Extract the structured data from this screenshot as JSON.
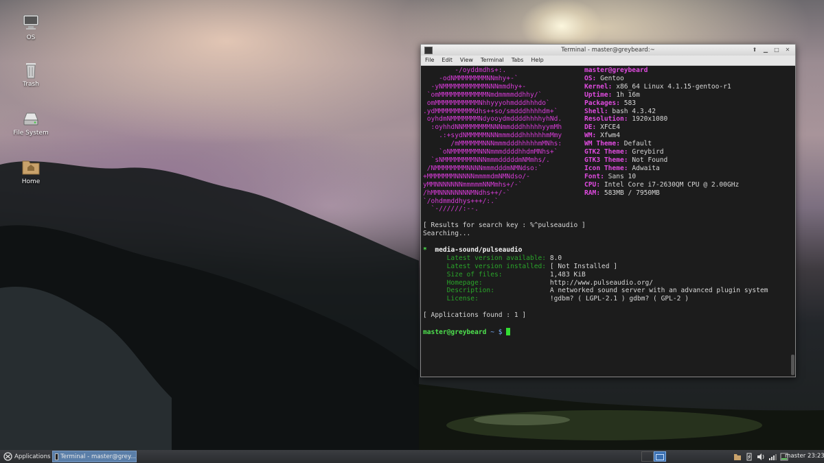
{
  "desktop_icons": [
    {
      "label": "OS",
      "icon": "monitor-icon"
    },
    {
      "label": "Trash",
      "icon": "trash-icon"
    },
    {
      "label": "File System",
      "icon": "drive-icon"
    },
    {
      "label": "Home",
      "icon": "home-folder-icon"
    }
  ],
  "terminal": {
    "title": "Terminal - master@greybeard:~",
    "menu": [
      "File",
      "Edit",
      "View",
      "Terminal",
      "Tabs",
      "Help"
    ],
    "logo_lines": [
      "        -/oyddmdhs+:.",
      "    -odNMMMMMMMMNNmhy+-`",
      "  -yNMMMMMMMMMMMNNNmmdhy+-",
      " `omMMMMMMMMMMMMNmdmmmmddhhy/`",
      " omMMMMMMMMMMMNhhyyyohmdddhhhdo`",
      ".ydMMMMMMMMMMdhs++so/smdddhhhhdm+`",
      " oyhdmNMMMMMMMNdyooydmddddhhhhyhNd.",
      "  :oyhhdNNMMMMMMMNNNmmdddhhhhhyymMh",
      "    .:+sydNMMMMMNNNmmmdddhhhhhhmMmy",
      "       /mMMMMMMNNNmmmdddhhhhhmMNhs:",
      "    `oNMMMMMMMNNNmmmddddhhdmMNhs+`",
      "  `sNMMMMMMMMNNNmmmdddddmNMmhs/.",
      " /NMMMMMMMMNNNNmmmdddmNMNdso:`",
      "+MMMMMMMNNNNNmmmmdmNMNdso/-",
      "yMMNNNNNNNmmmmmNNMmhs+/-`",
      "/hMMNNNNNNNNMNdhs++/-`",
      "`/ohdmmddhys+++/:.`",
      "  `-//////:--."
    ],
    "info": [
      {
        "key": "master@greybeard",
        "value": ""
      },
      {
        "key": "OS:",
        "value": "Gentoo"
      },
      {
        "key": "Kernel:",
        "value": "x86_64 Linux 4.1.15-gentoo-r1"
      },
      {
        "key": "Uptime:",
        "value": "1h 16m"
      },
      {
        "key": "Packages:",
        "value": "583"
      },
      {
        "key": "Shell:",
        "value": "bash 4.3.42"
      },
      {
        "key": "Resolution:",
        "value": "1920x1080"
      },
      {
        "key": "DE:",
        "value": "XFCE4"
      },
      {
        "key": "WM:",
        "value": "Xfwm4"
      },
      {
        "key": "WM Theme:",
        "value": "Default"
      },
      {
        "key": "GTK2 Theme:",
        "value": "Greybird"
      },
      {
        "key": "GTK3 Theme:",
        "value": "Not Found"
      },
      {
        "key": "Icon Theme:",
        "value": "Adwaita"
      },
      {
        "key": "Font:",
        "value": "Sans 10"
      },
      {
        "key": "CPU:",
        "value": "Intel Core i7-2630QM CPU @ 2.00GHz"
      },
      {
        "key": "RAM:",
        "value": "583MB / 7950MB"
      }
    ],
    "search_header": "[ Results for search key : %^pulseaudio ]",
    "searching": "Searching...",
    "package_marker": "*",
    "package_name": "media-sound/pulseaudio",
    "package_fields": [
      {
        "label": "Latest version available:",
        "value": "8.0"
      },
      {
        "label": "Latest version installed:",
        "value": "[ Not Installed ]"
      },
      {
        "label": "Size of files:",
        "value": "1,483 KiB"
      },
      {
        "label": "Homepage:",
        "value": "http://www.pulseaudio.org/"
      },
      {
        "label": "Description:",
        "value": "A networked sound server with an advanced plugin system"
      },
      {
        "label": "License:",
        "value": "!gdbm? ( LGPL-2.1 ) gdbm? ( GPL-2 )"
      }
    ],
    "apps_found": "[ Applications found : 1 ]",
    "prompt_user": "master@greybeard",
    "prompt_path": "~ $"
  },
  "taskbar": {
    "applications_label": "Applications",
    "task_label": "Terminal - master@grey...",
    "user": "master",
    "clock": "23:23"
  },
  "colors": {
    "logo": "#d63bd6",
    "info_key": "#e04be0",
    "prompt": "#4ee04e",
    "active_task": "#5a7ea8"
  }
}
